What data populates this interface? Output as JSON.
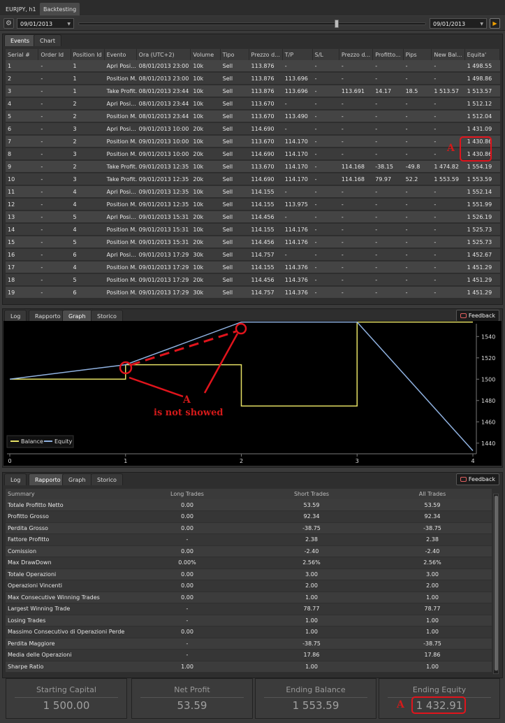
{
  "window": {
    "tabs": [
      {
        "label": "EURJPY, h1",
        "active": false
      },
      {
        "label": "Backtesting",
        "active": true
      }
    ]
  },
  "toolbar": {
    "start_date": "09/01/2013",
    "end_date": "09/01/2013"
  },
  "events_panel": {
    "tabs": [
      {
        "label": "Events",
        "active": true
      },
      {
        "label": "Chart",
        "active": false
      }
    ],
    "columns": [
      "Serial #",
      "Order Id",
      "Position Id",
      "Evento",
      "Ora (UTC+2)",
      "Volume",
      "Tipo",
      "Prezzo d...",
      "T/P",
      "S/L",
      "Prezzo d...",
      "Profitto...",
      "Pips",
      "New Bal...",
      "Equita'"
    ],
    "rows": [
      [
        "1",
        "-",
        "1",
        "Apri  Posi...",
        "08/01/2013 23:00",
        "10k",
        "Sell",
        "113.876",
        "-",
        "-",
        "-",
        "-",
        "-",
        "-",
        "1 498.55"
      ],
      [
        "2",
        "-",
        "1",
        "Position M...",
        "08/01/2013 23:00",
        "10k",
        "Sell",
        "113.876",
        "113.696",
        "-",
        "-",
        "-",
        "-",
        "-",
        "1 498.86"
      ],
      [
        "3",
        "-",
        "1",
        "Take Profit...",
        "08/01/2013 23:44",
        "10k",
        "Sell",
        "113.876",
        "113.696",
        "-",
        "113.691",
        "14.17",
        "18.5",
        "1 513.57",
        "1 513.57"
      ],
      [
        "4",
        "-",
        "2",
        "Apri  Posi...",
        "08/01/2013 23:44",
        "10k",
        "Sell",
        "113.670",
        "-",
        "-",
        "-",
        "-",
        "-",
        "-",
        "1 512.12"
      ],
      [
        "5",
        "-",
        "2",
        "Position M...",
        "08/01/2013 23:44",
        "10k",
        "Sell",
        "113.670",
        "113.490",
        "-",
        "-",
        "-",
        "-",
        "-",
        "1 512.04"
      ],
      [
        "6",
        "-",
        "3",
        "Apri  Posi...",
        "09/01/2013 10:00",
        "20k",
        "Sell",
        "114.690",
        "-",
        "-",
        "-",
        "-",
        "-",
        "-",
        "1 431.09"
      ],
      [
        "7",
        "-",
        "2",
        "Position M...",
        "09/01/2013 10:00",
        "10k",
        "Sell",
        "113.670",
        "114.170",
        "-",
        "-",
        "-",
        "-",
        "-",
        "1 430.86"
      ],
      [
        "8",
        "-",
        "3",
        "Position M...",
        "09/01/2013 10:00",
        "20k",
        "Sell",
        "114.690",
        "114.170",
        "-",
        "-",
        "-",
        "-",
        "-",
        "1 430.86"
      ],
      [
        "9",
        "-",
        "2",
        "Take Profit...",
        "09/01/2013 12:35",
        "10k",
        "Sell",
        "113.670",
        "114.170",
        "-",
        "114.168",
        "-38.15",
        "-49.8",
        "1 474.82",
        "1 554.19"
      ],
      [
        "10",
        "-",
        "3",
        "Take Profit...",
        "09/01/2013 12:35",
        "20k",
        "Sell",
        "114.690",
        "114.170",
        "-",
        "114.168",
        "79.97",
        "52.2",
        "1 553.59",
        "1 553.59"
      ],
      [
        "11",
        "-",
        "4",
        "Apri  Posi...",
        "09/01/2013 12:35",
        "10k",
        "Sell",
        "114.155",
        "-",
        "-",
        "-",
        "-",
        "-",
        "-",
        "1 552.14"
      ],
      [
        "12",
        "-",
        "4",
        "Position M...",
        "09/01/2013 12:35",
        "10k",
        "Sell",
        "114.155",
        "113.975",
        "-",
        "-",
        "-",
        "-",
        "-",
        "1 551.99"
      ],
      [
        "13",
        "-",
        "5",
        "Apri  Posi...",
        "09/01/2013 15:31",
        "20k",
        "Sell",
        "114.456",
        "-",
        "-",
        "-",
        "-",
        "-",
        "-",
        "1 526.19"
      ],
      [
        "14",
        "-",
        "4",
        "Position M...",
        "09/01/2013 15:31",
        "10k",
        "Sell",
        "114.155",
        "114.176",
        "-",
        "-",
        "-",
        "-",
        "-",
        "1 525.73"
      ],
      [
        "15",
        "-",
        "5",
        "Position M...",
        "09/01/2013 15:31",
        "20k",
        "Sell",
        "114.456",
        "114.176",
        "-",
        "-",
        "-",
        "-",
        "-",
        "1 525.73"
      ],
      [
        "16",
        "-",
        "6",
        "Apri  Posi...",
        "09/01/2013 17:29",
        "30k",
        "Sell",
        "114.757",
        "-",
        "-",
        "-",
        "-",
        "-",
        "-",
        "1 452.67"
      ],
      [
        "17",
        "-",
        "4",
        "Position M...",
        "09/01/2013 17:29",
        "10k",
        "Sell",
        "114.155",
        "114.376",
        "-",
        "-",
        "-",
        "-",
        "-",
        "1 451.29"
      ],
      [
        "18",
        "-",
        "5",
        "Position M...",
        "09/01/2013 17:29",
        "20k",
        "Sell",
        "114.456",
        "114.376",
        "-",
        "-",
        "-",
        "-",
        "-",
        "1 451.29"
      ],
      [
        "19",
        "-",
        "6",
        "Position M...",
        "09/01/2013 17:29",
        "30k",
        "Sell",
        "114.757",
        "114.376",
        "-",
        "-",
        "-",
        "-",
        "-",
        "1 451.29"
      ]
    ]
  },
  "graph_panel": {
    "tabs": [
      {
        "label": "Log",
        "active": false
      },
      {
        "label": "Rapporto",
        "active": false
      },
      {
        "label": "Graph",
        "active": true
      },
      {
        "label": "Storico",
        "active": false
      }
    ],
    "feedback_label": "Feedback"
  },
  "chart_data": {
    "type": "line",
    "title": "",
    "xlabel": "",
    "ylabel": "",
    "xlim": [
      0,
      4
    ],
    "ylim": [
      1430,
      1552
    ],
    "x_ticks": [
      "0",
      "1",
      "2",
      "3",
      "4"
    ],
    "y_ticks": [
      "1440",
      "1460",
      "1480",
      "1500",
      "1520",
      "1540"
    ],
    "legend_position": "bottom-left",
    "grid": false,
    "series": [
      {
        "name": "Balance",
        "color": "#e5e064",
        "step": true,
        "points": [
          [
            0,
            1500
          ],
          [
            1,
            1500
          ],
          [
            1,
            1513.57
          ],
          [
            2,
            1513.57
          ],
          [
            2,
            1474.82
          ],
          [
            3,
            1474.82
          ],
          [
            3,
            1553.59
          ],
          [
            4,
            1553.59
          ]
        ]
      },
      {
        "name": "Equity",
        "color": "#8fb1e0",
        "step": false,
        "points": [
          [
            0,
            1500
          ],
          [
            1,
            1513.57
          ],
          [
            2,
            1553.59
          ],
          [
            3,
            1553.59
          ],
          [
            4,
            1432.91
          ]
        ]
      }
    ]
  },
  "annotations": {
    "marker": "A",
    "chart_note_line1": "A",
    "chart_note_line2": "is not showed"
  },
  "report_panel": {
    "tabs": [
      {
        "label": "Log",
        "active": false
      },
      {
        "label": "Rapporto",
        "active": true
      },
      {
        "label": "Graph",
        "active": false
      },
      {
        "label": "Storico",
        "active": false
      }
    ],
    "feedback_label": "Feedback",
    "columns": [
      "Summary",
      "Long Trades",
      "Short Trades",
      "All Trades"
    ],
    "rows": [
      [
        "Totale Profitto Netto",
        "0.00",
        "53.59",
        "53.59"
      ],
      [
        "Profitto Grosso",
        "0.00",
        "92.34",
        "92.34"
      ],
      [
        "Perdita Grosso",
        "0.00",
        "-38.75",
        "-38.75"
      ],
      [
        "Fattore Profitto",
        "-",
        "2.38",
        "2.38"
      ],
      [
        "Comission",
        "0.00",
        "-2.40",
        "-2.40"
      ],
      [
        "Max DrawDown",
        "0.00%",
        "2.56%",
        "2.56%"
      ],
      [
        "Totale Operazioni",
        "0.00",
        "3.00",
        "3.00"
      ],
      [
        "Operazioni Vincenti",
        "0.00",
        "2.00",
        "2.00"
      ],
      [
        "Max Consecutive Winning Trades",
        "0.00",
        "1.00",
        "1.00"
      ],
      [
        "Largest Winning Trade",
        "-",
        "78.77",
        "78.77"
      ],
      [
        "Losing Trades",
        "-",
        "1.00",
        "1.00"
      ],
      [
        "Massimo Consecutivo di Operazioni Perde",
        "0.00",
        "1.00",
        "1.00"
      ],
      [
        "Perdita Maggiore",
        "-",
        "-38.75",
        "-38.75"
      ],
      [
        "Media delle Operazioni",
        "-",
        "17.86",
        "17.86"
      ],
      [
        "Sharpe Ratio",
        "1.00",
        "1.00",
        "1.00"
      ]
    ]
  },
  "summary_cards": [
    {
      "label": "Starting Capital",
      "value": "1 500.00"
    },
    {
      "label": "Net Profit",
      "value": "53.59"
    },
    {
      "label": "Ending Balance",
      "value": "1 553.59"
    },
    {
      "label": "Ending Equity",
      "value": "1 432.91"
    }
  ],
  "colors": {
    "annotation_red": "#e0141c",
    "balance_line": "#e5e064",
    "equity_line": "#8fb1e0",
    "accent_play": "#f0a000"
  }
}
